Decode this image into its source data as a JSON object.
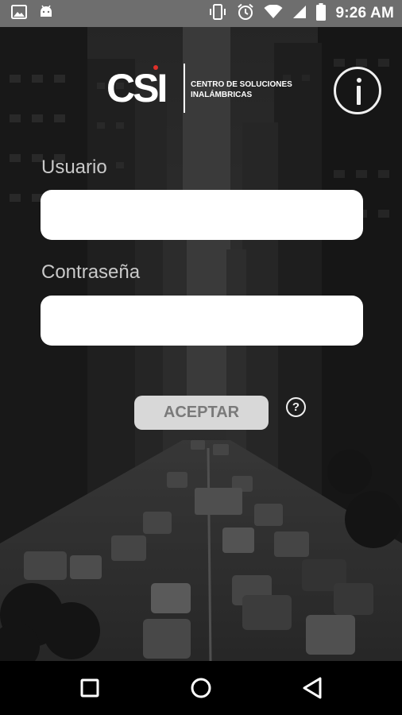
{
  "status_bar": {
    "time": "9:26 AM",
    "left_icons": [
      "image-icon",
      "android-icon"
    ],
    "right_icons": [
      "vibrate-icon",
      "alarm-icon",
      "wifi-icon",
      "signal-icon",
      "battery-icon"
    ]
  },
  "header": {
    "logo_mark": "CSI",
    "logo_line1": "CENTRO DE SOLUCIONES",
    "logo_line2": "INALÁMBRICAS",
    "info_icon": "info-icon"
  },
  "form": {
    "username_label": "Usuario",
    "username_value": "",
    "password_label": "Contraseña",
    "password_value": "",
    "accept_label": "ACEPTAR",
    "help_label": "?"
  },
  "nav_bar": {
    "icons": [
      "recent-apps-icon",
      "home-icon",
      "back-icon"
    ]
  },
  "colors": {
    "status_bar": "#6e6e6e",
    "accent_red": "#e0302a",
    "label_text": "#c9c9c9",
    "button_bg": "#d8d8d8",
    "button_text": "#7a7a7a"
  }
}
